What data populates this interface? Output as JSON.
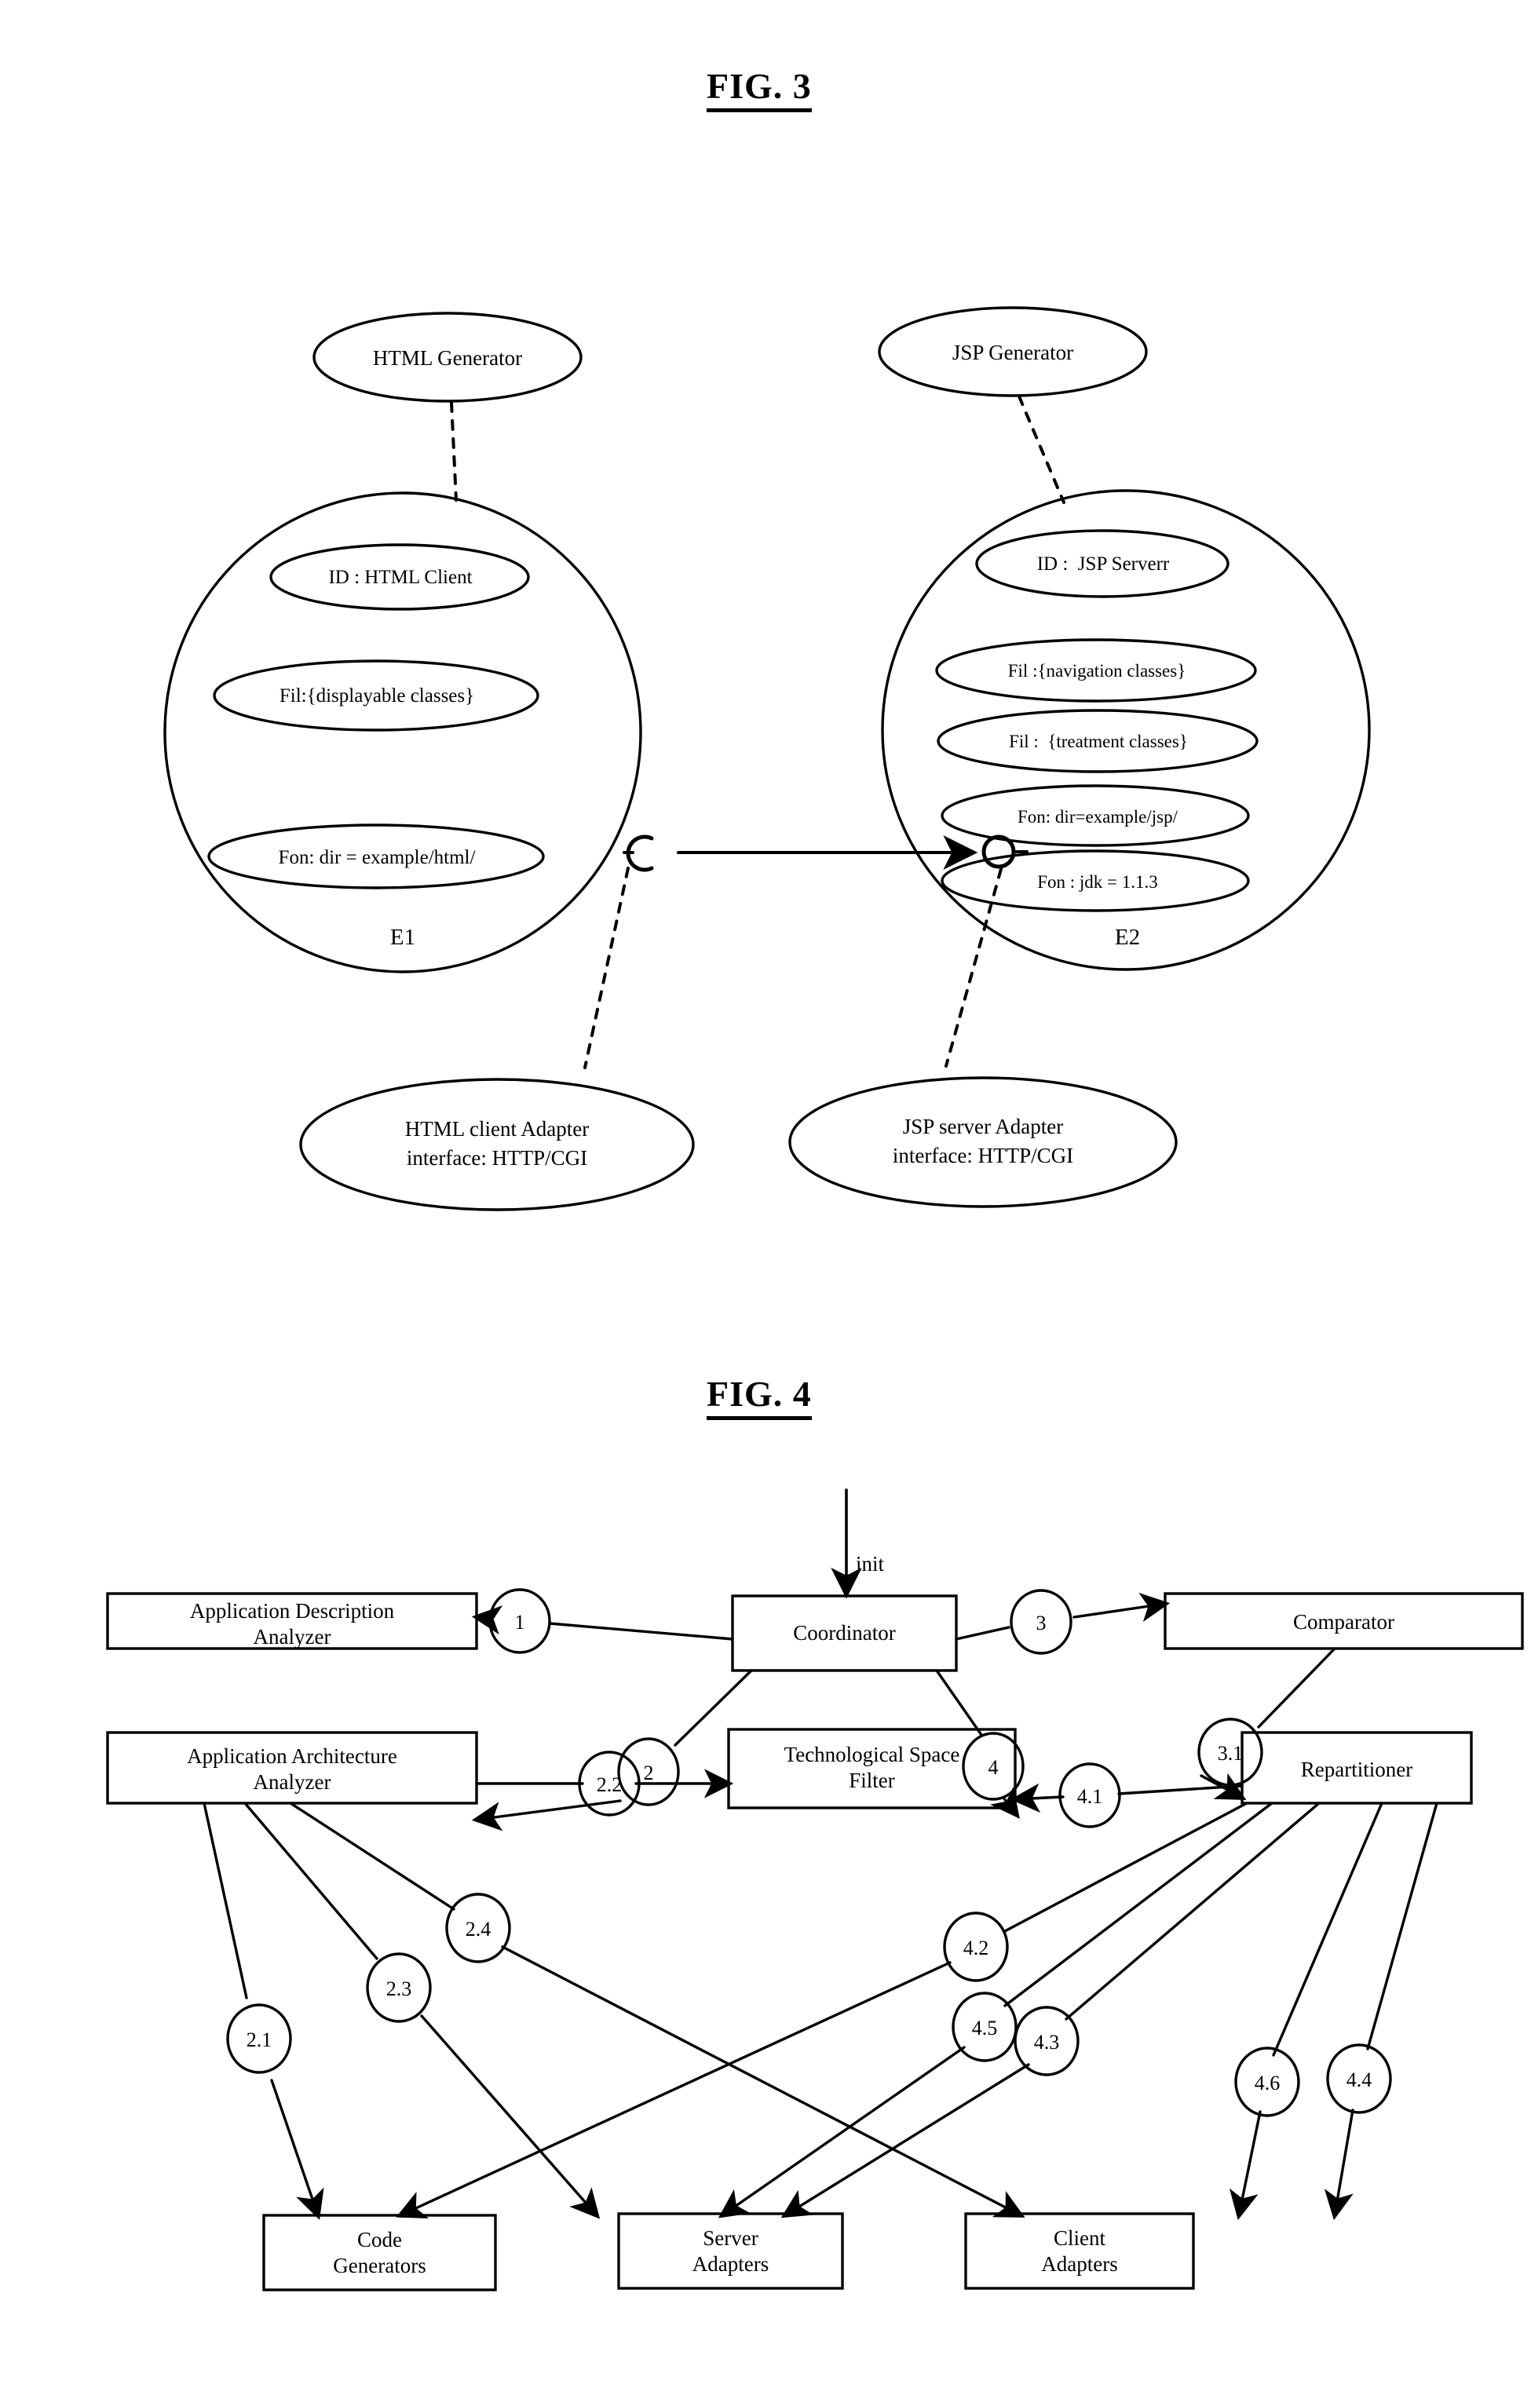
{
  "figures": [
    {
      "id": "fig3",
      "title": "FIG. 3",
      "generators": [
        {
          "name": "html-generator",
          "label": "HTML Generator"
        },
        {
          "name": "jsp-generator",
          "label": "JSP Generator"
        }
      ],
      "components": [
        {
          "name": "component-e1",
          "id_label": "E1",
          "attributes": [
            "ID : HTML Client",
            "Fil:{displayable classes}",
            "Fon: dir = example/html/"
          ]
        },
        {
          "name": "component-e2",
          "id_label": "E2",
          "attributes": [
            "ID :  JSP Serverr",
            "Fil :{navigation classes}",
            "Fil :  {treatment classes}",
            "Fon: dir=example/jsp/",
            "Fon : jdk = 1.1.3"
          ]
        }
      ],
      "adapters": [
        {
          "name": "html-client-adapter",
          "line1": "HTML client Adapter",
          "line2": "interface: HTTP/CGI"
        },
        {
          "name": "jsp-server-adapter",
          "line1": "JSP server Adapter",
          "line2": "interface: HTTP/CGI"
        }
      ],
      "connector": {
        "name": "required-provided-interface-connector",
        "left_symbol": "socket",
        "right_symbol": "ball",
        "direction": "left-to-right"
      }
    },
    {
      "id": "fig4",
      "title": "FIG. 4",
      "init_label": "init",
      "boxes": [
        {
          "name": "application-description-analyzer",
          "line1": "Application Description",
          "line2": "Analyzer"
        },
        {
          "name": "coordinator",
          "line1": "Coordinator",
          "line2": ""
        },
        {
          "name": "comparator",
          "line1": "Comparator",
          "line2": ""
        },
        {
          "name": "application-architecture-analyzer",
          "line1": "Application Architecture",
          "line2": "Analyzer"
        },
        {
          "name": "technological-space-filter",
          "line1": "Technological Space",
          "line2": "Filter"
        },
        {
          "name": "repartitioner",
          "line1": "Repartitioner",
          "line2": ""
        },
        {
          "name": "code-generators",
          "line1": "Code",
          "line2": "Generators"
        },
        {
          "name": "server-adapters",
          "line1": "Server",
          "line2": "Adapters"
        },
        {
          "name": "client-adapters",
          "line1": "Client",
          "line2": "Adapters"
        }
      ],
      "flow_labels": [
        {
          "name": "flow-label-1",
          "label": "1"
        },
        {
          "name": "flow-label-2",
          "label": "2"
        },
        {
          "name": "flow-label-3",
          "label": "3"
        },
        {
          "name": "flow-label-4",
          "label": "4"
        },
        {
          "name": "flow-label-3-1",
          "label": "3.1"
        },
        {
          "name": "flow-label-2-1",
          "label": "2.1"
        },
        {
          "name": "flow-label-2-2",
          "label": "2.2"
        },
        {
          "name": "flow-label-2-3",
          "label": "2.3"
        },
        {
          "name": "flow-label-2-4",
          "label": "2.4"
        },
        {
          "name": "flow-label-4-1",
          "label": "4.1"
        },
        {
          "name": "flow-label-4-2",
          "label": "4.2"
        },
        {
          "name": "flow-label-4-3",
          "label": "4.3"
        },
        {
          "name": "flow-label-4-4",
          "label": "4.4"
        },
        {
          "name": "flow-label-4-5",
          "label": "4.5"
        },
        {
          "name": "flow-label-4-6",
          "label": "4.6"
        }
      ]
    }
  ],
  "colors": {
    "ink": "#000000",
    "paper": "#ffffff"
  }
}
